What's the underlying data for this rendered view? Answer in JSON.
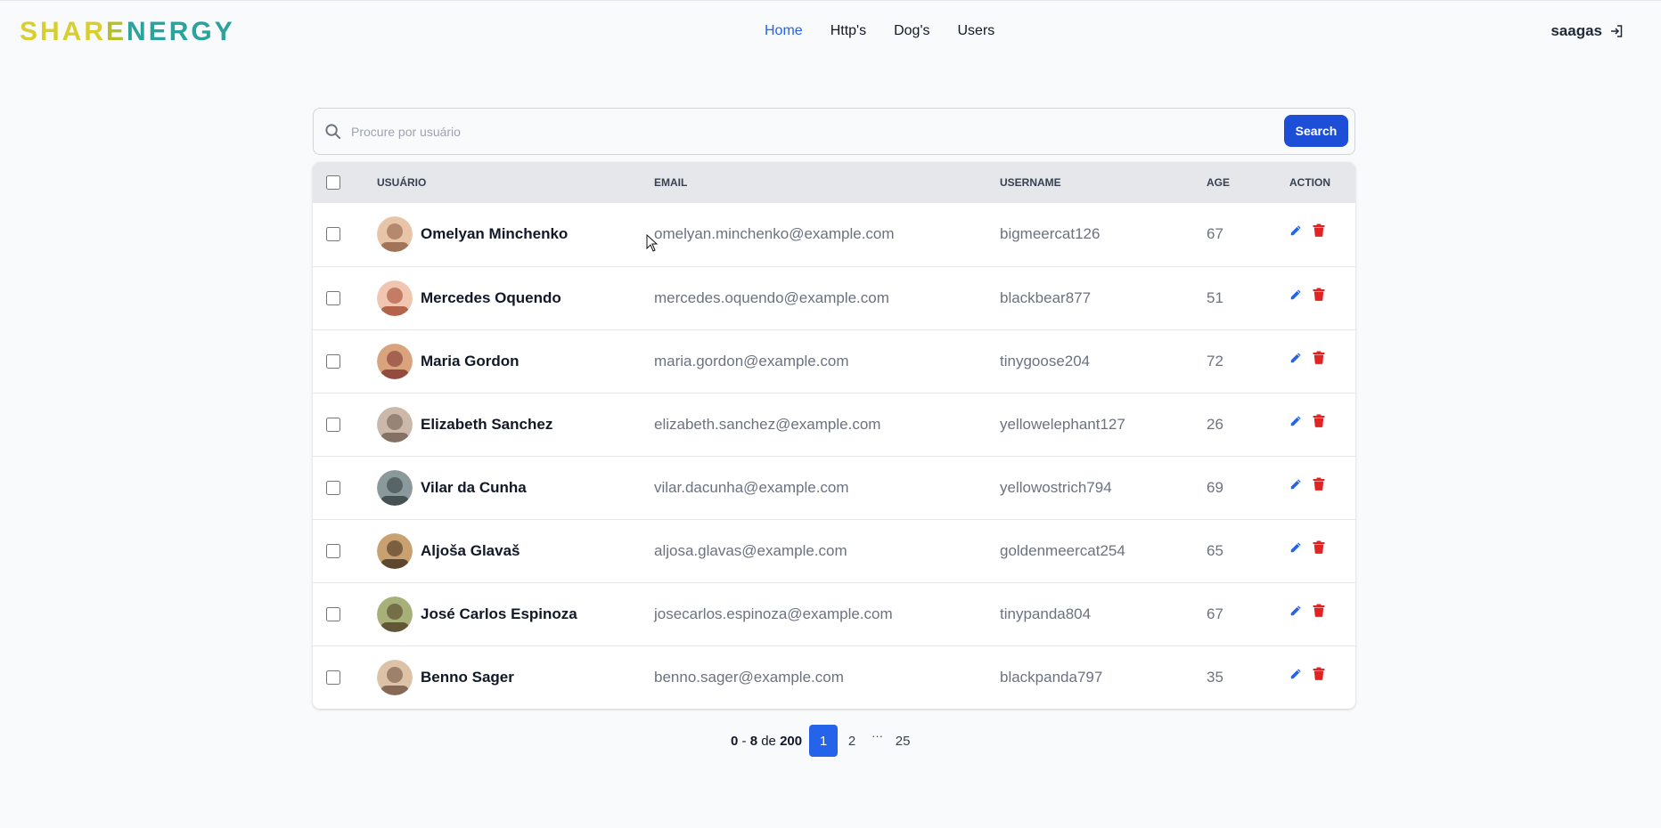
{
  "brand": {
    "part1": "SHAR",
    "part2": "E",
    "part3": "NERGY"
  },
  "nav": {
    "items": [
      "Home",
      "Http's",
      "Dog's",
      "Users"
    ],
    "active": "Home"
  },
  "account": {
    "username": "saagas",
    "logout_icon": "logout-icon"
  },
  "search": {
    "placeholder": "Procure por usuário",
    "value": "",
    "button_label": "Search"
  },
  "table": {
    "columns": [
      "USUÁRIO",
      "EMAIL",
      "USERNAME",
      "AGE",
      "ACTION"
    ],
    "rows": [
      {
        "name": "Omelyan Minchenko",
        "email": "omelyan.minchenko@example.com",
        "username": "bigmeercat126",
        "age": "67"
      },
      {
        "name": "Mercedes Oquendo",
        "email": "mercedes.oquendo@example.com",
        "username": "blackbear877",
        "age": "51"
      },
      {
        "name": "Maria Gordon",
        "email": "maria.gordon@example.com",
        "username": "tinygoose204",
        "age": "72"
      },
      {
        "name": "Elizabeth Sanchez",
        "email": "elizabeth.sanchez@example.com",
        "username": "yellowelephant127",
        "age": "26"
      },
      {
        "name": "Vilar da Cunha",
        "email": "vilar.dacunha@example.com",
        "username": "yellowostrich794",
        "age": "69"
      },
      {
        "name": "Aljoša Glavaš",
        "email": "aljosa.glavas@example.com",
        "username": "goldenmeercat254",
        "age": "65"
      },
      {
        "name": "José Carlos Espinoza",
        "email": "josecarlos.espinoza@example.com",
        "username": "tinypanda804",
        "age": "67"
      },
      {
        "name": "Benno Sager",
        "email": "benno.sager@example.com",
        "username": "blackpanda797",
        "age": "35"
      }
    ]
  },
  "pagination": {
    "from": "0",
    "to": "8",
    "of_word": "de",
    "total": "200",
    "pages": [
      "1",
      "2"
    ],
    "ellipsis": "···",
    "last_page": "25",
    "current": "1"
  },
  "colors": {
    "primary": "#2563eb",
    "search_button": "#1d4ed8",
    "delete": "#e02424",
    "edit": "#2563eb"
  }
}
